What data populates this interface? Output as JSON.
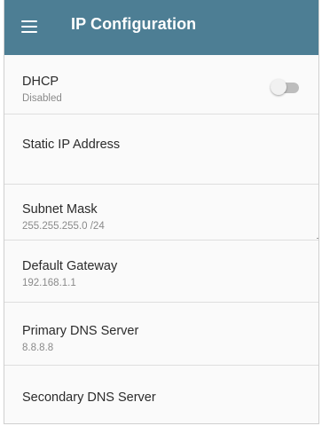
{
  "header": {
    "menu_icon": "hamburger-menu-icon",
    "title": "IP Configuration",
    "background": "#4d7e94"
  },
  "settings": [
    {
      "label": "DHCP",
      "value": "Disabled",
      "toggle": {
        "on": false
      }
    },
    {
      "label": "Static IP Address",
      "value": ""
    },
    {
      "label": "Subnet Mask",
      "value": "255.255.255.0 /24"
    },
    {
      "label": "Default Gateway",
      "value": "192.168.1.1"
    },
    {
      "label": "Primary DNS Server",
      "value": "8.8.8.8"
    },
    {
      "label": "Secondary DNS Server",
      "value": ""
    }
  ]
}
